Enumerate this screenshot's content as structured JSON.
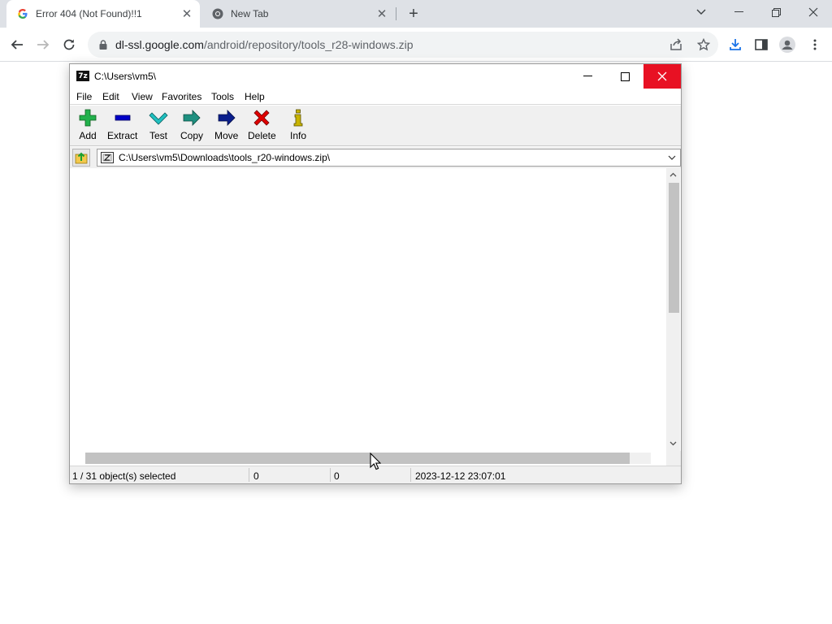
{
  "browser": {
    "tabs": [
      {
        "title": "Error 404 (Not Found)!!1",
        "favicon": "google-g-icon",
        "active": true
      },
      {
        "title": "New Tab",
        "favicon": "chrome-icon",
        "active": false
      }
    ],
    "url": {
      "host": "dl-ssl.google.com",
      "path": "/android/repository/tools_r28-windows.zip"
    }
  },
  "sevenzip": {
    "title": "C:\\Users\\vm5\\",
    "menu": [
      "File",
      "Edit",
      "View",
      "Favorites",
      "Tools",
      "Help"
    ],
    "toolbar": [
      {
        "label": "Add",
        "icon": "add-plus-icon",
        "color": "#22b14c"
      },
      {
        "label": "Extract",
        "icon": "extract-minus-icon",
        "color": "#0000c8"
      },
      {
        "label": "Test",
        "icon": "test-check-icon",
        "color": "#20c0c0"
      },
      {
        "label": "Copy",
        "icon": "copy-arrow-icon",
        "color": "#1e9080"
      },
      {
        "label": "Move",
        "icon": "move-arrow-icon",
        "color": "#0a1e8c"
      },
      {
        "label": "Delete",
        "icon": "delete-x-icon",
        "color": "#e00000"
      },
      {
        "label": "Info",
        "icon": "info-i-icon",
        "color": "#c8b400"
      }
    ],
    "path": "C:\\Users\\vm5\\Downloads\\tools_r20-windows.zip\\",
    "status": {
      "selection": "1 / 31 object(s) selected",
      "size": "0",
      "packed": "0",
      "modified": "2023-12-12 23:07:01"
    }
  }
}
